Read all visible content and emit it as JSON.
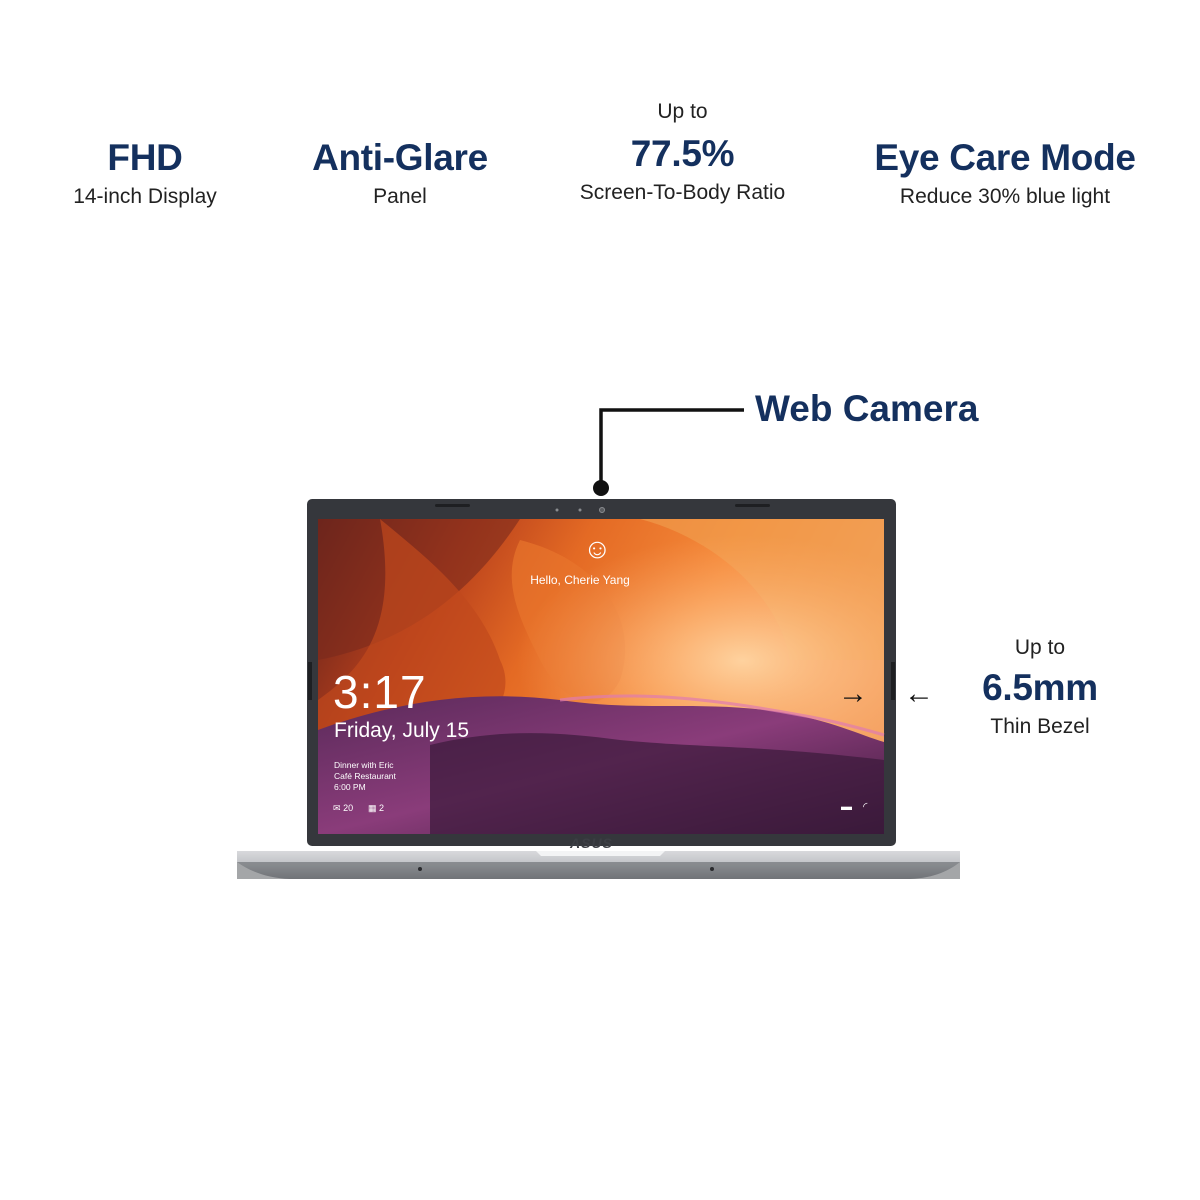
{
  "features": [
    {
      "pre": "",
      "title": "FHD",
      "subtitle": "14-inch Display"
    },
    {
      "pre": "",
      "title": "Anti-Glare",
      "subtitle": "Panel"
    },
    {
      "pre": "Up to",
      "title": "77.5%",
      "subtitle": "Screen-To-Body Ratio"
    },
    {
      "pre": "",
      "title": "Eye Care Mode",
      "subtitle": "Reduce 30% blue light"
    }
  ],
  "callouts": {
    "camera": {
      "label": "Web Camera"
    },
    "bezel": {
      "pre": "Up to",
      "title": "6.5mm",
      "subtitle": "Thin Bezel"
    }
  },
  "screen": {
    "time": "3:17",
    "date": "Friday, July 15",
    "event_line1": "Dinner with Eric",
    "event_line2": "Café Restaurant",
    "event_line3": "6:00 PM",
    "user": "Hello, Cherie Yang",
    "mail_count": "20",
    "calendar_count": "2"
  },
  "brand": "ASUS",
  "colors": {
    "accent": "#14305e"
  },
  "icons": [
    "smiley-icon",
    "mail-icon",
    "calendar-icon",
    "battery-icon",
    "wifi-icon",
    "arrow-right-icon",
    "arrow-left-icon"
  ]
}
